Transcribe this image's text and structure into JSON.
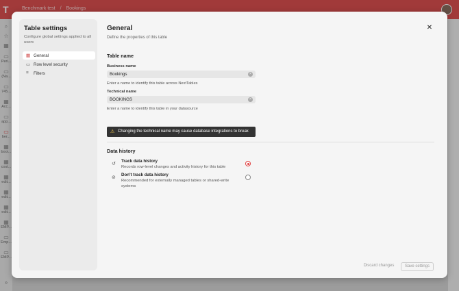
{
  "background": {
    "breadcrumbs": [
      "Benchmark test",
      "/",
      "Bookings"
    ],
    "rail_items": [
      "Peri...",
      "(Na...",
      "745...",
      "Acc...",
      "app...",
      "ber...",
      "booi...",
      "cost...",
      "edit...",
      "edit...",
      "edit...",
      "EMP...",
      "Emp...",
      "EMP..."
    ]
  },
  "sidebar": {
    "title": "Table settings",
    "subtitle": "Configure global settings applied to all users",
    "items": [
      {
        "label": "General",
        "icon": "grid-icon",
        "glyph": "▦"
      },
      {
        "label": "Row level security",
        "icon": "id-card-icon",
        "glyph": "▭"
      },
      {
        "label": "Filters",
        "icon": "filter-icon",
        "glyph": "≡"
      }
    ]
  },
  "main": {
    "title": "General",
    "description": "Define the properties of this table",
    "close_glyph": "✕",
    "table_name_section": "Table name",
    "business_name": {
      "label": "Business name",
      "value": "Bookings",
      "help": "Enter a name to identify this table across NextTables"
    },
    "technical_name": {
      "label": "Technical name",
      "value": "BOOKINGS",
      "help": "Enter a name to identify this table in your datasource"
    },
    "warning": {
      "glyph": "⚠",
      "text": "Changing the technical name may cause database integrations to break"
    },
    "data_history_section": "Data history",
    "options": [
      {
        "title": "Track data history",
        "description": "Records row-level changes and activity history for this table",
        "selected": true,
        "icon": "history-icon",
        "glyph": "↺"
      },
      {
        "title": "Don't track data history",
        "description": "Recommended for externally managed tables or shared-write systems",
        "selected": false,
        "icon": "history-off-icon",
        "glyph": "⊘"
      }
    ],
    "discard_label": "Discard changes",
    "save_label": "Save settings"
  },
  "colors": {
    "brand": "#d73a3a",
    "accent": "#e04040",
    "warning_bg": "#333333"
  }
}
